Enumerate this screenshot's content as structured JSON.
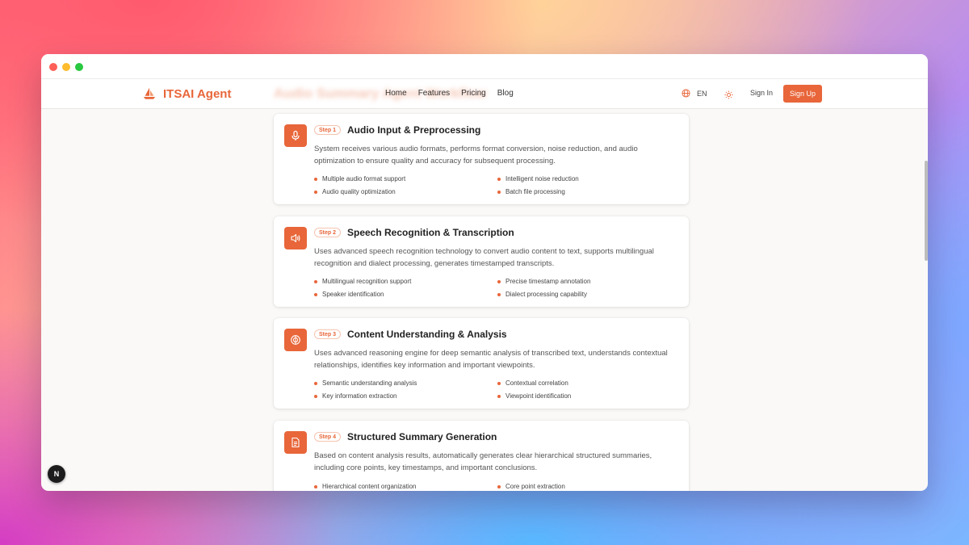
{
  "brand": {
    "name": "ITSAI Agent",
    "accent": "#e8663a"
  },
  "header": {
    "ghost_title": "Audio Summary Agent Workflow"
  },
  "nav": {
    "home": "Home",
    "features": "Features",
    "pricing": "Pricing",
    "blog": "Blog"
  },
  "lang": {
    "label": "EN"
  },
  "auth": {
    "sign_in": "Sign In",
    "sign_up": "Sign Up"
  },
  "steps": [
    {
      "badge": "Step 1",
      "icon": "microphone-icon",
      "title": "Audio Input & Preprocessing",
      "desc": "System receives various audio formats, performs format conversion, noise reduction, and audio optimization to ensure quality and accuracy for subsequent processing.",
      "features": [
        "Multiple audio format support",
        "Intelligent noise reduction",
        "Audio quality optimization",
        "Batch file processing"
      ]
    },
    {
      "badge": "Step 2",
      "icon": "speaker-icon",
      "title": "Speech Recognition & Transcription",
      "desc": "Uses advanced speech recognition technology to convert audio content to text, supports multilingual recognition and dialect processing, generates timestamped transcripts.",
      "features": [
        "Multilingual recognition support",
        "Precise timestamp annotation",
        "Speaker identification",
        "Dialect processing capability"
      ]
    },
    {
      "badge": "Step 3",
      "icon": "brain-icon",
      "title": "Content Understanding & Analysis",
      "desc": "Uses advanced reasoning engine for deep semantic analysis of transcribed text, understands contextual relationships, identifies key information and important viewpoints.",
      "features": [
        "Semantic understanding analysis",
        "Contextual correlation",
        "Key information extraction",
        "Viewpoint identification"
      ]
    },
    {
      "badge": "Step 4",
      "icon": "document-icon",
      "title": "Structured Summary Generation",
      "desc": "Based on content analysis results, automatically generates clear hierarchical structured summaries, including core points, key timestamps, and important conclusions.",
      "features": [
        "Hierarchical content organization",
        "Core point extraction"
      ]
    }
  ],
  "floating_badge": "N"
}
